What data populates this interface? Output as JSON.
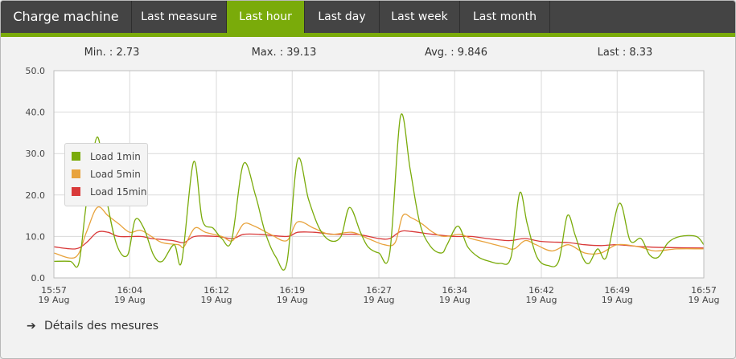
{
  "tabs": {
    "title": "Charge machine",
    "items": [
      {
        "label": "Last measure",
        "active": false
      },
      {
        "label": "Last hour",
        "active": true
      },
      {
        "label": "Last day",
        "active": false
      },
      {
        "label": "Last week",
        "active": false
      },
      {
        "label": "Last month",
        "active": false
      }
    ]
  },
  "stats": {
    "min": "Min. : 2.73",
    "max": "Max. : 39.13",
    "avg": "Avg. : 9.846",
    "last": "Last : 8.33"
  },
  "details_link": "Détails des mesures",
  "colors": {
    "accent": "#7aab0a",
    "load1": "#7aab0a",
    "load5": "#e8a33d",
    "load15": "#d93a3a"
  },
  "icons": {
    "details": "arrow-right-icon"
  },
  "chart_data": {
    "type": "line",
    "yticks": [
      "0.0",
      "10.0",
      "20.0",
      "30.0",
      "40.0",
      "50.0"
    ],
    "ylim": [
      0,
      50
    ],
    "xlim": [
      0,
      60
    ],
    "grid": true,
    "legend_position": "left",
    "xticks": [
      {
        "t": 0,
        "time": "15:57",
        "date": "19 Aug"
      },
      {
        "t": 7,
        "time": "16:04",
        "date": "19 Aug"
      },
      {
        "t": 15,
        "time": "16:12",
        "date": "19 Aug"
      },
      {
        "t": 22,
        "time": "16:19",
        "date": "19 Aug"
      },
      {
        "t": 30,
        "time": "16:27",
        "date": "19 Aug"
      },
      {
        "t": 37,
        "time": "16:34",
        "date": "19 Aug"
      },
      {
        "t": 45,
        "time": "16:42",
        "date": "19 Aug"
      },
      {
        "t": 52,
        "time": "16:49",
        "date": "19 Aug"
      },
      {
        "t": 60,
        "time": "16:57",
        "date": "19 Aug"
      }
    ],
    "series": [
      {
        "name": "Load 1min",
        "color": "#7aab0a",
        "points": [
          [
            0,
            4
          ],
          [
            1.5,
            4
          ],
          [
            2.3,
            3.5
          ],
          [
            3,
            18
          ],
          [
            4,
            34
          ],
          [
            4.8,
            20
          ],
          [
            5.8,
            8
          ],
          [
            6.8,
            5.5
          ],
          [
            7.5,
            14
          ],
          [
            8.3,
            12
          ],
          [
            9.2,
            5.5
          ],
          [
            10,
            4
          ],
          [
            11.1,
            8
          ],
          [
            11.8,
            4
          ],
          [
            12.9,
            28
          ],
          [
            13.7,
            14
          ],
          [
            14.7,
            12
          ],
          [
            15.5,
            9.5
          ],
          [
            16.4,
            9
          ],
          [
            17.5,
            27.5
          ],
          [
            18.6,
            20
          ],
          [
            19.5,
            11
          ],
          [
            20.5,
            5
          ],
          [
            21.5,
            3.5
          ],
          [
            22.5,
            28.5
          ],
          [
            23.5,
            19
          ],
          [
            24.5,
            12
          ],
          [
            25.5,
            9
          ],
          [
            26.5,
            10
          ],
          [
            27.3,
            17
          ],
          [
            28.3,
            11
          ],
          [
            29,
            7.5
          ],
          [
            30,
            6
          ],
          [
            31,
            6
          ],
          [
            32,
            39
          ],
          [
            32.9,
            26
          ],
          [
            33.8,
            13
          ],
          [
            34.8,
            7.5
          ],
          [
            35.8,
            6
          ],
          [
            36.3,
            8
          ],
          [
            37.3,
            12.5
          ],
          [
            38.2,
            7.5
          ],
          [
            39.2,
            5
          ],
          [
            40.2,
            4
          ],
          [
            41.2,
            3.5
          ],
          [
            42.2,
            5
          ],
          [
            43,
            20.5
          ],
          [
            43.7,
            13
          ],
          [
            44.6,
            5
          ],
          [
            45.6,
            3
          ],
          [
            46.6,
            4
          ],
          [
            47.4,
            15
          ],
          [
            48.1,
            10.5
          ],
          [
            48.8,
            5
          ],
          [
            49.4,
            3.5
          ],
          [
            50.2,
            7
          ],
          [
            51,
            5
          ],
          [
            52.2,
            18
          ],
          [
            53.2,
            9
          ],
          [
            54.2,
            9.5
          ],
          [
            55,
            5.5
          ],
          [
            55.8,
            5
          ],
          [
            56.7,
            8.5
          ],
          [
            57.8,
            10
          ],
          [
            59.3,
            10
          ],
          [
            60,
            8
          ]
        ]
      },
      {
        "name": "Load 5min",
        "color": "#e8a33d",
        "points": [
          [
            0,
            6
          ],
          [
            2,
            5
          ],
          [
            3,
            11
          ],
          [
            4,
            17
          ],
          [
            5,
            15
          ],
          [
            6,
            13
          ],
          [
            7,
            11
          ],
          [
            8,
            11.5
          ],
          [
            9,
            10
          ],
          [
            10,
            8.5
          ],
          [
            11.5,
            8
          ],
          [
            12,
            7.5
          ],
          [
            13,
            12
          ],
          [
            14,
            11
          ],
          [
            15.5,
            10
          ],
          [
            16.5,
            9
          ],
          [
            17.5,
            13
          ],
          [
            18.5,
            12.5
          ],
          [
            20,
            10.5
          ],
          [
            21.5,
            9
          ],
          [
            22.5,
            13.5
          ],
          [
            24,
            12
          ],
          [
            25.5,
            10.5
          ],
          [
            27.5,
            11
          ],
          [
            29,
            9.5
          ],
          [
            30.5,
            8
          ],
          [
            31.5,
            8.5
          ],
          [
            32.2,
            15
          ],
          [
            33,
            14.5
          ],
          [
            34,
            13
          ],
          [
            35,
            11
          ],
          [
            36,
            10
          ],
          [
            37.5,
            10.5
          ],
          [
            38.5,
            9.5
          ],
          [
            40,
            8.5
          ],
          [
            41.5,
            7.5
          ],
          [
            42.5,
            7
          ],
          [
            43.5,
            9
          ],
          [
            44.5,
            8
          ],
          [
            46,
            6.5
          ],
          [
            47.5,
            8
          ],
          [
            49,
            6
          ],
          [
            50.5,
            6
          ],
          [
            52,
            8
          ],
          [
            54,
            7.5
          ],
          [
            55.5,
            6.5
          ],
          [
            57.5,
            7
          ],
          [
            60,
            7
          ]
        ]
      },
      {
        "name": "Load 15min",
        "color": "#d93a3a",
        "points": [
          [
            0,
            7.5
          ],
          [
            2,
            7
          ],
          [
            3,
            8.5
          ],
          [
            4,
            11
          ],
          [
            5,
            11
          ],
          [
            6,
            10
          ],
          [
            8,
            10
          ],
          [
            9,
            9.5
          ],
          [
            11,
            9
          ],
          [
            12,
            8.5
          ],
          [
            13,
            10
          ],
          [
            15,
            10
          ],
          [
            16.5,
            9.5
          ],
          [
            17.5,
            10.5
          ],
          [
            19,
            10.5
          ],
          [
            21.5,
            10
          ],
          [
            22.5,
            11
          ],
          [
            24,
            11
          ],
          [
            26,
            10.5
          ],
          [
            28,
            10.5
          ],
          [
            30,
            9.5
          ],
          [
            31,
            9.5
          ],
          [
            32,
            11.2
          ],
          [
            33,
            11.2
          ],
          [
            35,
            10.5
          ],
          [
            37,
            10
          ],
          [
            38.5,
            10
          ],
          [
            40,
            9.5
          ],
          [
            42,
            9
          ],
          [
            43.5,
            9.5
          ],
          [
            45,
            8.8
          ],
          [
            47.5,
            8.5
          ],
          [
            49,
            8
          ],
          [
            50.5,
            7.8
          ],
          [
            52,
            8
          ],
          [
            54.5,
            7.5
          ],
          [
            57,
            7.3
          ],
          [
            60,
            7.2
          ]
        ]
      }
    ]
  }
}
